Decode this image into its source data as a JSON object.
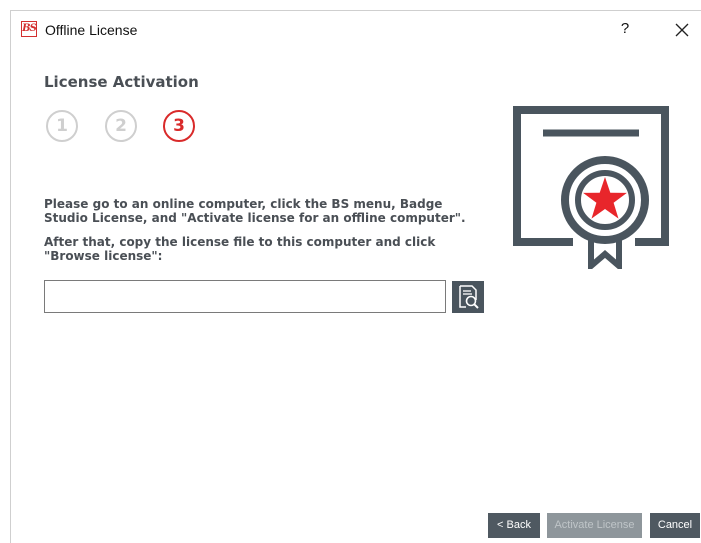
{
  "window": {
    "app_icon_text": "BS",
    "title": "Offline License",
    "help_label": "?"
  },
  "page": {
    "heading": "License Activation",
    "steps": [
      {
        "label": "1",
        "state": "inactive"
      },
      {
        "label": "2",
        "state": "inactive"
      },
      {
        "label": "3",
        "state": "active"
      }
    ],
    "instructions_1": "Please go to an online computer, click the BS menu, Badge Studio License, and \"Activate license for an offline computer\".",
    "instructions_2": "After that, copy the license file to this computer and click \"Browse license\":"
  },
  "license_field": {
    "value": "",
    "placeholder": ""
  },
  "icons": {
    "browse": "file-search-icon",
    "certificate": "certificate-icon",
    "close": "close-icon"
  },
  "buttons": {
    "back": "< Back",
    "activate": "Activate License",
    "cancel": "Cancel"
  },
  "colors": {
    "accent": "#d92a2a",
    "dark": "#4a555e",
    "inactive_step": "#cfcfcf",
    "disabled_button": "#8e969b"
  }
}
